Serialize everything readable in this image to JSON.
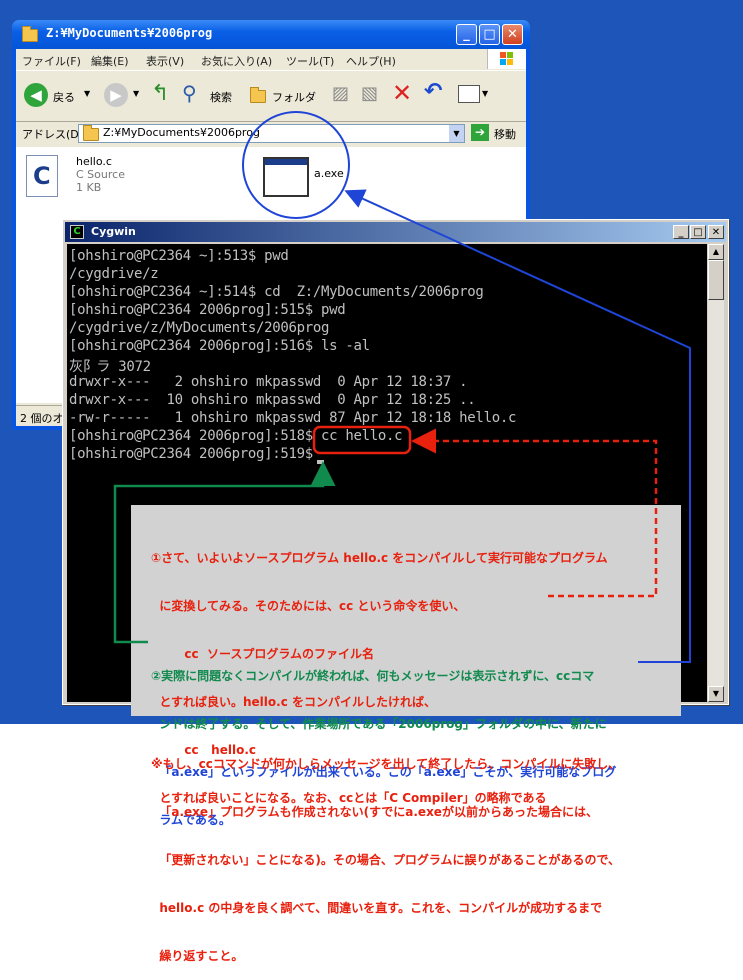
{
  "explorer": {
    "title": "Z:¥MyDocuments¥2006prog",
    "menu": [
      "ファイル(F)",
      "編集(E)",
      "表示(V)",
      "お気に入り(A)",
      "ツール(T)",
      "ヘルプ(H)"
    ],
    "toolbar": {
      "back": "戻る",
      "search": "検索",
      "folders": "フォルダ"
    },
    "address_label": "アドレス(D)",
    "address_value": "Z:¥MyDocuments¥2006prog",
    "go_label": "移動",
    "files": [
      {
        "name": "hello.c",
        "type": "C Source",
        "size": "1 KB",
        "icon": "c-source-icon"
      },
      {
        "name": "a.exe",
        "icon": "exe-window-icon"
      }
    ],
    "status": "2 個のオ"
  },
  "cygwin": {
    "title": "Cygwin",
    "lines": [
      "[ohshiro@PC2364 ~]:513$ pwd",
      "/cygdrive/z",
      "[ohshiro@PC2364 ~]:514$ cd  Z:/MyDocuments/2006prog",
      "[ohshiro@PC2364 2006prog]:515$ pwd",
      "/cygdrive/z/MyDocuments/2006prog",
      "[ohshiro@PC2364 2006prog]:516$ ls -al",
      "灰阝ラ 3072",
      "drwxr-x---   2 ohshiro mkpasswd  0 Apr 12 18:37 .",
      "drwxr-x---  10 ohshiro mkpasswd  0 Apr 12 18:25 ..",
      "-rw-r-----   1 ohshiro mkpasswd 87 Apr 12 18:18 hello.c",
      "[ohshiro@PC2364 2006prog]:518$ cc hello.c",
      "[ohshiro@PC2364 2006prog]:519$ "
    ]
  },
  "notes": {
    "note1": [
      "①さて、いよいよソースプログラム hello.c をコンパイルして実行可能なプログラム",
      "  に変換してみる。そのためには、cc という命令を使い、",
      "        cc  ソースプログラムのファイル名",
      "  とすれば良い。hello.c をコンパイルしたければ、",
      "        cc   hello.c",
      "  とすれば良いことになる。なお、ccとは「C Compiler」の略称である"
    ],
    "note2": [
      "②実際に問題なくコンパイルが終われば、何もメッセージは表示されずに、ccコマ",
      "  ンドは終了する。そして、作業場所である「2006prog」フォルダの中に、新たに",
      "  「a.exe」というファイルが出来ている。この「a.exe」こそが、実行可能なプログ",
      "  ラムである。"
    ],
    "note3": [
      "※もし、ccコマンドが何かしらメッセージを出して終了したら、コンパイルに失敗し、",
      "  「a.exe」プログラムも作成されない(すでにa.exeが以前からあった場合には、",
      "  「更新されない」ことになる)。その場合、プログラムに誤りがあることがあるので、",
      "  hello.c の中身を良く調べて、間違いを直す。これを、コンパイルが成功するまで",
      "  繰り返すこと。"
    ]
  },
  "colors": {
    "note1": "#e8200e",
    "note2": "#118a4e",
    "note3": "#e8200e",
    "arrow_blue": "#1f45d6"
  }
}
